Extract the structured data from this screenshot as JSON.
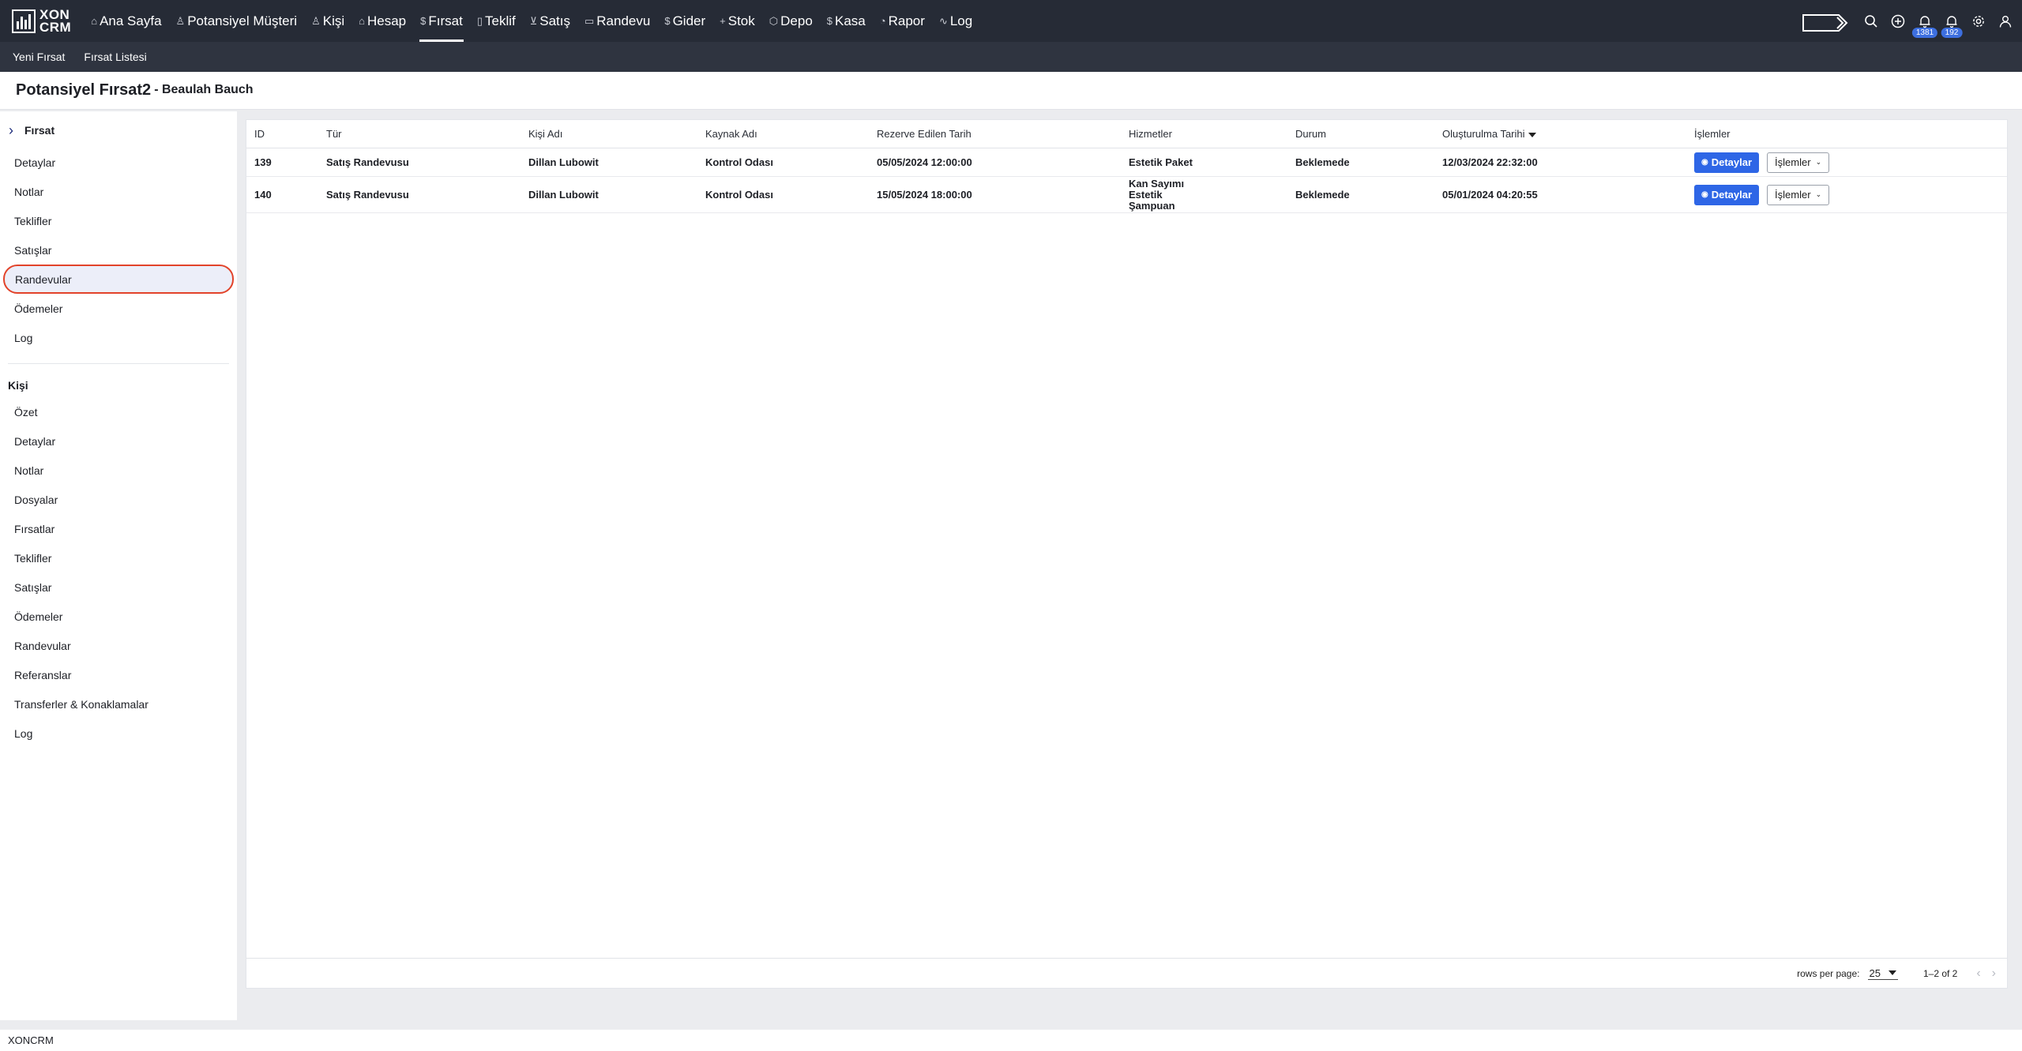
{
  "brand": {
    "line1": "XON",
    "line2": "CRM"
  },
  "nav": [
    {
      "label": "Ana Sayfa",
      "icon": "home-icon",
      "glyph": "⌂"
    },
    {
      "label": "Potansiyel Müşteri",
      "icon": "user-icon",
      "glyph": "♙"
    },
    {
      "label": "Kişi",
      "icon": "users-icon",
      "glyph": "♙"
    },
    {
      "label": "Hesap",
      "icon": "building-icon",
      "glyph": "⌂"
    },
    {
      "label": "Fırsat",
      "icon": "dollar-icon",
      "glyph": "$"
    },
    {
      "label": "Teklif",
      "icon": "document-icon",
      "glyph": "▯"
    },
    {
      "label": "Satış",
      "icon": "cart-icon",
      "glyph": "⊻"
    },
    {
      "label": "Randevu",
      "icon": "calendar-icon",
      "glyph": "▭"
    },
    {
      "label": "Gider",
      "icon": "dollar-icon",
      "glyph": "$"
    },
    {
      "label": "Stok",
      "icon": "plus-icon",
      "glyph": "+"
    },
    {
      "label": "Depo",
      "icon": "box-icon",
      "glyph": "⬡"
    },
    {
      "label": "Kasa",
      "icon": "dollar-icon",
      "glyph": "$"
    },
    {
      "label": "Rapor",
      "icon": "pie-chart-icon",
      "glyph": "◔"
    },
    {
      "label": "Log",
      "icon": "activity-icon",
      "glyph": "∿"
    }
  ],
  "notifications": {
    "bell1_count": "1381",
    "bell2_count": "192"
  },
  "subnav": [
    "Yeni Fırsat",
    "Fırsat Listesi"
  ],
  "page": {
    "title": "Potansiyel Fırsat2",
    "subtitle": "- Beaulah Bauch"
  },
  "sidebar": {
    "group_title": "Fırsat",
    "items": [
      "Detaylar",
      "Notlar",
      "Teklifler",
      "Satışlar",
      "Randevular",
      "Ödemeler",
      "Log"
    ],
    "section_title": "Kişi",
    "section_items": [
      "Özet",
      "Detaylar",
      "Notlar",
      "Dosyalar",
      "Fırsatlar",
      "Teklifler",
      "Satışlar",
      "Ödemeler",
      "Randevular",
      "Referanslar",
      "Transferler & Konaklamalar",
      "Log"
    ]
  },
  "table": {
    "columns": [
      "ID",
      "Tür",
      "Kişi Adı",
      "Kaynak Adı",
      "Rezerve Edilen Tarih",
      "Hizmetler",
      "Durum",
      "Oluşturulma Tarihi",
      "İşlemler"
    ],
    "rows": [
      {
        "id": "139",
        "type": "Satış Randevusu",
        "person": "Dillan Lubowit",
        "source": "Kontrol Odası",
        "reserved": "05/05/2024 12:00:00",
        "services": [
          "Estetik Paket"
        ],
        "status": "Beklemede",
        "created": "12/03/2024 22:32:00"
      },
      {
        "id": "140",
        "type": "Satış Randevusu",
        "person": "Dillan Lubowit",
        "source": "Kontrol Odası",
        "reserved": "15/05/2024 18:00:00",
        "services": [
          "Kan Sayımı",
          "Estetik",
          "Şampuan"
        ],
        "status": "Beklemede",
        "created": "05/01/2024 04:20:55"
      }
    ],
    "detail_label": "Detaylar",
    "ops_label": "İşlemler"
  },
  "pager": {
    "rows_label": "rows per page:",
    "rows_value": "25",
    "range": "1–2 of 2"
  },
  "footer": "XONCRM"
}
